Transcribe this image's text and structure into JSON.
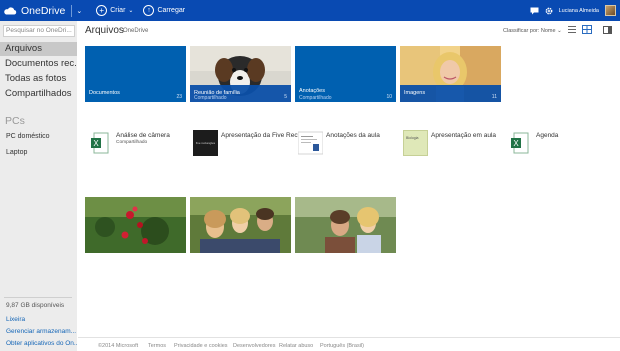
{
  "app": {
    "name": "OneDrive"
  },
  "topbar": {
    "create_label": "Criar",
    "upload_label": "Carregar",
    "user_name": "Luciana Almeida",
    "bar_color": "#094ab2"
  },
  "sidebar": {
    "search_placeholder": "Pesquisar no OneDri...",
    "items": [
      {
        "label": "Arquivos",
        "active": true
      },
      {
        "label": "Documentos rec..."
      },
      {
        "label": "Todas as fotos"
      },
      {
        "label": "Compartilhados"
      }
    ],
    "pcs_title": "PCs",
    "pcs": [
      "PC doméstico",
      "Laptop"
    ],
    "storage": "9,87 GB disponíveis",
    "links": [
      "Lixeira",
      "Gerenciar armazenam...",
      "Obter aplicativos do On..."
    ]
  },
  "main": {
    "title": "Arquivos",
    "breadcrumb": "OneDrive",
    "sort_label": "Classificar por: Nome",
    "folders": [
      {
        "name": "Documentos",
        "sub": "",
        "count": "23",
        "kind": "blue"
      },
      {
        "name": "Reunião de família",
        "sub": "Compartilhado",
        "count": "5",
        "kind": "dog"
      },
      {
        "name": "Anotações",
        "sub": "Compartilhado",
        "count": "10",
        "kind": "blue"
      },
      {
        "name": "Imagens",
        "sub": "",
        "count": "11",
        "kind": "woman"
      }
    ],
    "files": [
      {
        "name": "Análise de câmera",
        "sub": "Compartilhado",
        "type": "excel-icon"
      },
      {
        "name": "Apresentação da Five Recta",
        "sub": "",
        "type": "ppt-dark"
      },
      {
        "name": "Anotações da aula",
        "sub": "",
        "type": "doc-thumb"
      },
      {
        "name": "Apresentação em aula",
        "sub": "",
        "type": "ppt-bio"
      },
      {
        "name": "Agenda",
        "sub": "",
        "type": "excel-icon"
      }
    ],
    "thumb_texts": {
      "five_recta": "five rectangles",
      "biologia": "Biologia"
    }
  },
  "footer": {
    "items": [
      "©2014 Microsoft",
      "Termos",
      "Privacidade e cookies",
      "Desenvolvedores",
      "Relatar abuso",
      "Português (Brasil)"
    ]
  },
  "colors": {
    "accent": "#094ab2",
    "tile_blue": "#0060b0",
    "link": "#1566b7"
  }
}
